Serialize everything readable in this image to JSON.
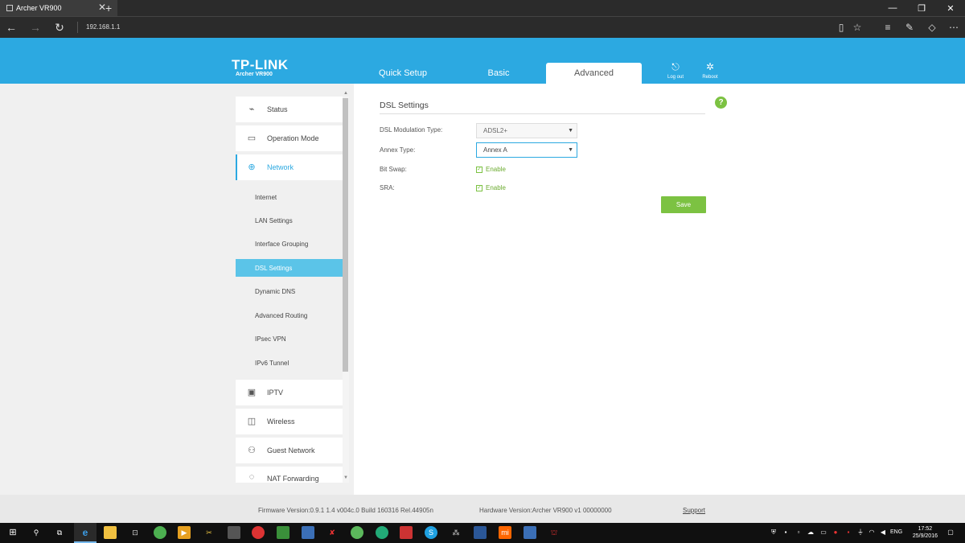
{
  "browser": {
    "tab_title": "Archer VR900",
    "tab_close": "✕",
    "new_tab": "+",
    "url": "192.168.1.1",
    "window_controls": [
      "—",
      "❐",
      "✕"
    ]
  },
  "router": {
    "logo": "TP-LINK",
    "model": "Archer VR900",
    "tabs": [
      "Quick Setup",
      "Basic",
      "Advanced"
    ],
    "active_tab": "Advanced",
    "logout_label": "Log out",
    "reboot_label": "Reboot"
  },
  "sidebar": {
    "items_top": [
      {
        "label": "Status",
        "icon": "status-icon"
      },
      {
        "label": "Operation Mode",
        "icon": "monitor-icon"
      },
      {
        "label": "Network",
        "icon": "globe-icon"
      }
    ],
    "sub_items": [
      "Internet",
      "LAN Settings",
      "Interface Grouping",
      "DSL Settings",
      "Dynamic DNS",
      "Advanced Routing",
      "IPsec VPN",
      "IPv6 Tunnel"
    ],
    "selected_sub": "DSL Settings",
    "items_bottom": [
      {
        "label": "IPTV",
        "icon": "tv-icon"
      },
      {
        "label": "Wireless",
        "icon": "wifi-icon"
      },
      {
        "label": "Guest Network",
        "icon": "guests-icon"
      },
      {
        "label": "NAT Forwarding",
        "icon": "nat-icon"
      }
    ]
  },
  "content": {
    "title": "DSL Settings",
    "help": "?",
    "fields": {
      "modulation_label": "DSL Modulation Type:",
      "modulation_value": "ADSL2+",
      "annex_label": "Annex Type:",
      "annex_value": "Annex A",
      "bitswap_label": "Bit Swap:",
      "bitswap_option": "Enable",
      "sra_label": "SRA:",
      "sra_option": "Enable"
    },
    "save_label": "Save"
  },
  "footer": {
    "firmware": "Firmware Version:0.9.1 1.4 v004c.0 Build 160316 Rel.44905n",
    "hardware": "Hardware Version:Archer VR900 v1 00000000",
    "support": "Support"
  },
  "taskbar": {
    "lang": "ENG",
    "time": "17:52",
    "date": "25/9/2016"
  }
}
